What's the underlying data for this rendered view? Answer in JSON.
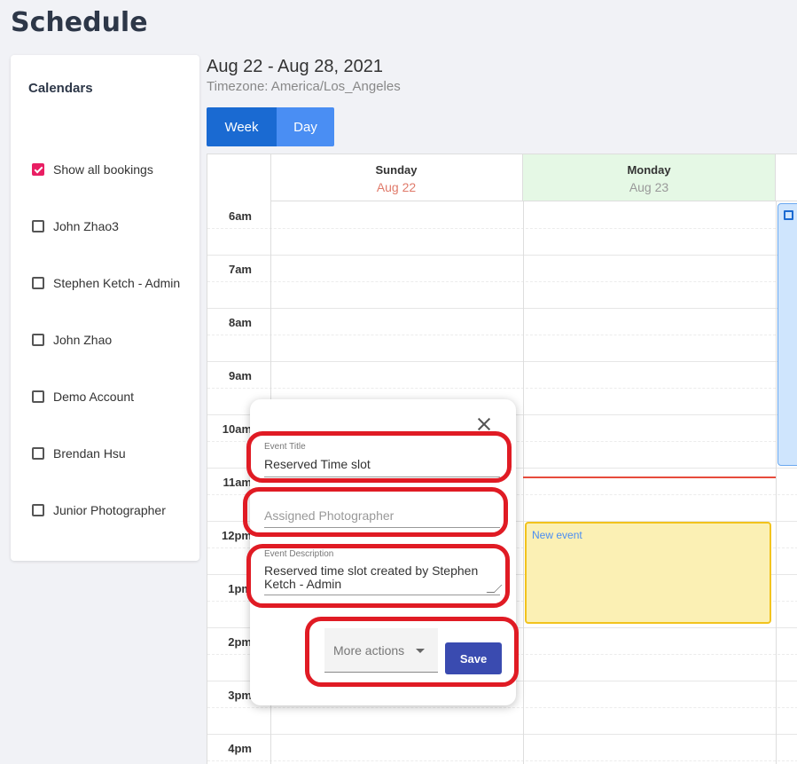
{
  "page": {
    "title": "Schedule"
  },
  "sidebar": {
    "title": "Calendars",
    "items": [
      {
        "label": "Show all bookings",
        "checked": true
      },
      {
        "label": "John Zhao3",
        "checked": false
      },
      {
        "label": "Stephen Ketch - Admin",
        "checked": false
      },
      {
        "label": "John Zhao",
        "checked": false
      },
      {
        "label": "Demo Account",
        "checked": false
      },
      {
        "label": "Brendan Hsu",
        "checked": false
      },
      {
        "label": "Junior Photographer",
        "checked": false
      }
    ]
  },
  "header": {
    "date_range": "Aug 22 - Aug 28, 2021",
    "timezone": "Timezone: America/Los_Angeles",
    "views": {
      "week": "Week",
      "day": "Day"
    }
  },
  "calendar": {
    "days": [
      {
        "name": "Sunday",
        "date": "Aug 22"
      },
      {
        "name": "Monday",
        "date": "Aug 23"
      }
    ],
    "times": [
      "6am",
      "7am",
      "8am",
      "9am",
      "10am",
      "11am",
      "12pm",
      "1pm",
      "2pm",
      "3pm",
      "4pm"
    ],
    "events": {
      "new_event": "New event"
    }
  },
  "popup": {
    "event_title_label": "Event Title",
    "event_title_value": "Reserved Time slot",
    "assigned_photographer_placeholder": "Assigned Photographer",
    "event_description_label": "Event Description",
    "event_description_value": "Reserved time slot created by Stephen Ketch - Admin",
    "more_actions": "More actions",
    "save": "Save"
  },
  "colors": {
    "accent_pink": "#e91e63",
    "week_button": "#1a6ad2",
    "day_button": "#4a8ef3",
    "save_button": "#3a4bb0",
    "highlight_red": "#e01b24",
    "now_line": "#e74c3c",
    "new_event_bg": "#fbf0b4"
  }
}
